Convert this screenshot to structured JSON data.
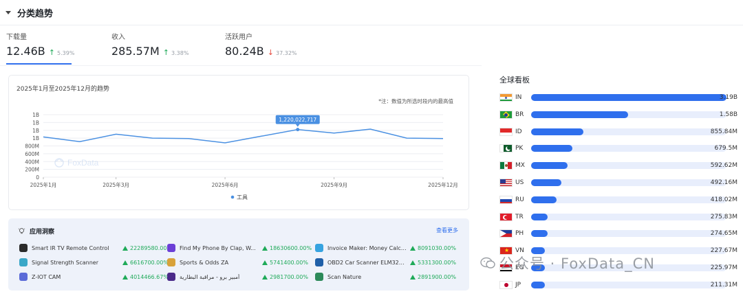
{
  "section": {
    "title": "分类趋势"
  },
  "metrics": [
    {
      "label": "下载量",
      "value": "12.46B",
      "direction": "up",
      "arrow": "↑",
      "change": "5.39%"
    },
    {
      "label": "收入",
      "value": "285.57M",
      "direction": "up",
      "arrow": "↑",
      "change": "3.38%"
    },
    {
      "label": "活跃用户",
      "value": "80.24B",
      "direction": "down",
      "arrow": "↓",
      "change": "37.32%"
    }
  ],
  "chart": {
    "title": "2025年1月至2025年12月的趋势",
    "note": "*注：数值为所选时段内的最高值",
    "watermark": "FoxData",
    "tooltip": "1,220,022,717"
  },
  "chart_data": {
    "type": "line",
    "x": [
      "2025-01",
      "2025-02",
      "2025-03",
      "2025-04",
      "2025-05",
      "2025-06",
      "2025-07",
      "2025-08",
      "2025-09",
      "2025-10",
      "2025-11",
      "2025-12"
    ],
    "x_tick_labels": [
      {
        "i": 0,
        "label": "2025年1月"
      },
      {
        "i": 2,
        "label": "2025年3月"
      },
      {
        "i": 5,
        "label": "2025年6月"
      },
      {
        "i": 8,
        "label": "2025年9月"
      },
      {
        "i": 11,
        "label": "2025年12月"
      }
    ],
    "y_tick_labels": [
      "0",
      "200M",
      "400M",
      "600M",
      "800M",
      "1B",
      "1B",
      "1B",
      "1B"
    ],
    "ylim": [
      0,
      1600000000
    ],
    "series": [
      {
        "name": "工具",
        "color": "#4a90e2",
        "values": [
          1030000000,
          910000000,
          1100000000,
          1000000000,
          990000000,
          880000000,
          1050000000,
          1220022717,
          1130000000,
          1230000000,
          1000000000,
          990000000
        ]
      }
    ],
    "highlight_index": 7,
    "legend": "bottom",
    "grid": true
  },
  "insights": {
    "title": "应用洞察",
    "more_label": "查看更多",
    "apps": [
      {
        "name": "Smart IR TV Remote Control",
        "growth": "22289580.00%",
        "icon_color": "#2b2b2b"
      },
      {
        "name": "Find My Phone By Clap, W...",
        "growth": "18630600.00%",
        "icon_color": "#6b3fd6"
      },
      {
        "name": "Invoice Maker: Money CalcTool",
        "growth": "8091030.00%",
        "icon_color": "#36a3e0"
      },
      {
        "name": "Signal Strength Scanner",
        "growth": "6616700.00%",
        "icon_color": "#3aa7c8"
      },
      {
        "name": "Sports & Odds ZA",
        "growth": "5741400.00%",
        "icon_color": "#d8a23a"
      },
      {
        "name": "OBD2 Car Scanner ELM327 ...",
        "growth": "5331300.00%",
        "icon_color": "#1f5fa8"
      },
      {
        "name": "Z-IOT CAM",
        "growth": "4014466.67%",
        "icon_color": "#5b6bd8"
      },
      {
        "name": "أمبير برو - مراقبة البطارية",
        "growth": "2981700.00%",
        "icon_color": "#4b2a8a"
      },
      {
        "name": "Scan Nature",
        "growth": "2891900.00%",
        "icon_color": "#2d8a5a"
      }
    ]
  },
  "global": {
    "title": "全球看板",
    "countries": [
      {
        "code": "IN",
        "value": "3.19B",
        "share": 1.0
      },
      {
        "code": "BR",
        "value": "1.58B",
        "share": 0.495
      },
      {
        "code": "ID",
        "value": "855.84M",
        "share": 0.268
      },
      {
        "code": "PK",
        "value": "679.5M",
        "share": 0.213
      },
      {
        "code": "MX",
        "value": "592.62M",
        "share": 0.186
      },
      {
        "code": "US",
        "value": "492.16M",
        "share": 0.154
      },
      {
        "code": "RU",
        "value": "418.02M",
        "share": 0.131
      },
      {
        "code": "TR",
        "value": "275.83M",
        "share": 0.086
      },
      {
        "code": "PH",
        "value": "274.65M",
        "share": 0.086
      },
      {
        "code": "VN",
        "value": "227.67M",
        "share": 0.071
      },
      {
        "code": "EG",
        "value": "225.97M",
        "share": 0.071
      },
      {
        "code": "JP",
        "value": "211.31M",
        "share": 0.066
      }
    ]
  },
  "watermark_text": "公众号 · FoxData_CN"
}
